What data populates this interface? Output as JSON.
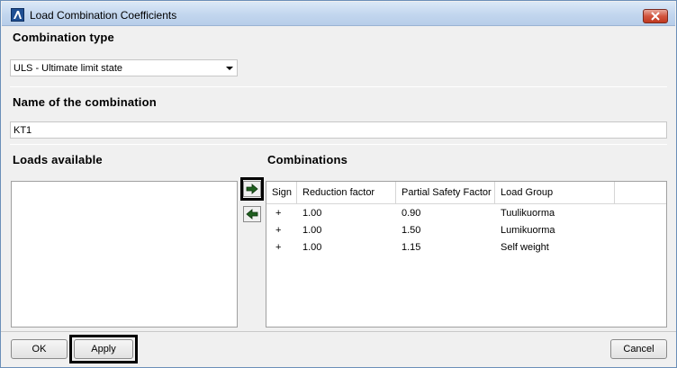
{
  "window": {
    "title": "Load Combination Coefficients",
    "icon": "app-logo-icon",
    "close_icon": "close-x-icon"
  },
  "combination_type": {
    "label": "Combination type",
    "selected": "ULS - Ultimate limit state"
  },
  "combination_name": {
    "label": "Name of the combination",
    "value": "KT1"
  },
  "loads_available": {
    "label": "Loads available",
    "items": []
  },
  "transfer_buttons": {
    "add_icon": "arrow-right-icon",
    "remove_icon": "arrow-left-icon"
  },
  "combinations": {
    "label": "Combinations",
    "columns": [
      "Sign",
      "Reduction factor",
      "Partial Safety Factor",
      "Load Group"
    ],
    "rows": [
      {
        "sign": "+",
        "reduction": "1.00",
        "psf": "0.90",
        "group": "Tuulikuorma"
      },
      {
        "sign": "+",
        "reduction": "1.00",
        "psf": "1.50",
        "group": "Lumikuorma"
      },
      {
        "sign": "+",
        "reduction": "1.00",
        "psf": "1.15",
        "group": "Self weight"
      }
    ]
  },
  "buttons": {
    "ok": "OK",
    "apply": "Apply",
    "cancel": "Cancel"
  },
  "colors": {
    "arrow_fill": "#1f5f1f",
    "highlight_border": "#000000",
    "close_button": "#c0391f"
  }
}
